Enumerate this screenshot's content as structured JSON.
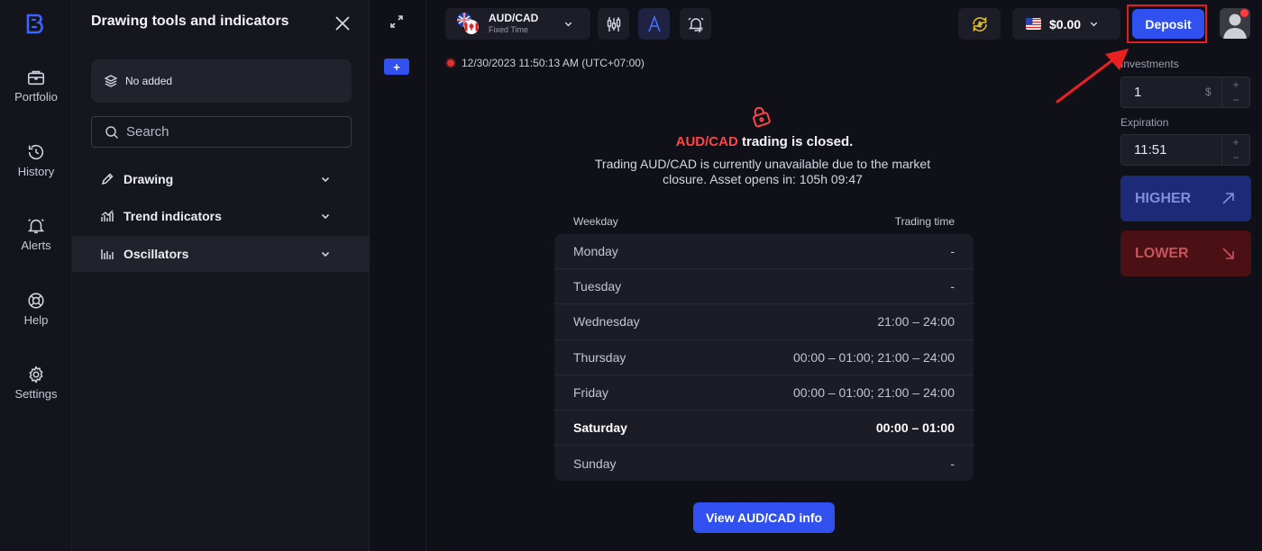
{
  "rail": {
    "items": [
      {
        "label": "Portfolio",
        "icon": "briefcase-icon"
      },
      {
        "label": "History",
        "icon": "history-icon"
      },
      {
        "label": "Alerts",
        "icon": "bell-icon"
      },
      {
        "label": "Help",
        "icon": "lifebuoy-icon"
      },
      {
        "label": "Settings",
        "icon": "gear-icon"
      }
    ]
  },
  "panel": {
    "title": "Drawing tools and indicators",
    "no_added": "No added",
    "search_placeholder": "Search",
    "sections": [
      {
        "label": "Drawing",
        "icon": "pencil-icon"
      },
      {
        "label": "Trend indicators",
        "icon": "trend-icon"
      },
      {
        "label": "Oscillators",
        "icon": "oscillator-icon",
        "active": true
      }
    ]
  },
  "strip": {
    "plus_label": "+"
  },
  "asset": {
    "name": "AUD/CAD",
    "type": "Fixed Time"
  },
  "header": {
    "balance": "$0.00",
    "deposit_label": "Deposit"
  },
  "timestamp": "12/30/2023 11:50:13 AM  (UTC+07:00)",
  "closed": {
    "asset": "AUD/CAD",
    "title_rest": " trading is closed.",
    "description": "Trading AUD/CAD is currently unavailable due to the market closure. Asset opens in: 105h 09:47"
  },
  "schedule": {
    "col_weekday": "Weekday",
    "col_time": "Trading time",
    "rows": [
      {
        "day": "Monday",
        "time": "-"
      },
      {
        "day": "Tuesday",
        "time": "-"
      },
      {
        "day": "Wednesday",
        "time": "21:00 – 24:00"
      },
      {
        "day": "Thursday",
        "time": "00:00 – 01:00; 21:00 – 24:00"
      },
      {
        "day": "Friday",
        "time": "00:00 – 01:00; 21:00 – 24:00"
      },
      {
        "day": "Saturday",
        "time": "00:00 – 01:00",
        "current": true
      },
      {
        "day": "Sunday",
        "time": "-"
      }
    ]
  },
  "info_button": "View AUD/CAD info",
  "trade": {
    "investments_label": "Investments",
    "investment_value": "1",
    "currency_unit": "$",
    "expiration_label": "Expiration",
    "expiration_value": "11:51",
    "stepper_plus": "+",
    "stepper_minus": "−",
    "higher_label": "HIGHER",
    "lower_label": "LOWER"
  },
  "colors": {
    "accent": "#3050f0",
    "closed_red": "#ff4545",
    "annotation_red": "#e02020"
  }
}
